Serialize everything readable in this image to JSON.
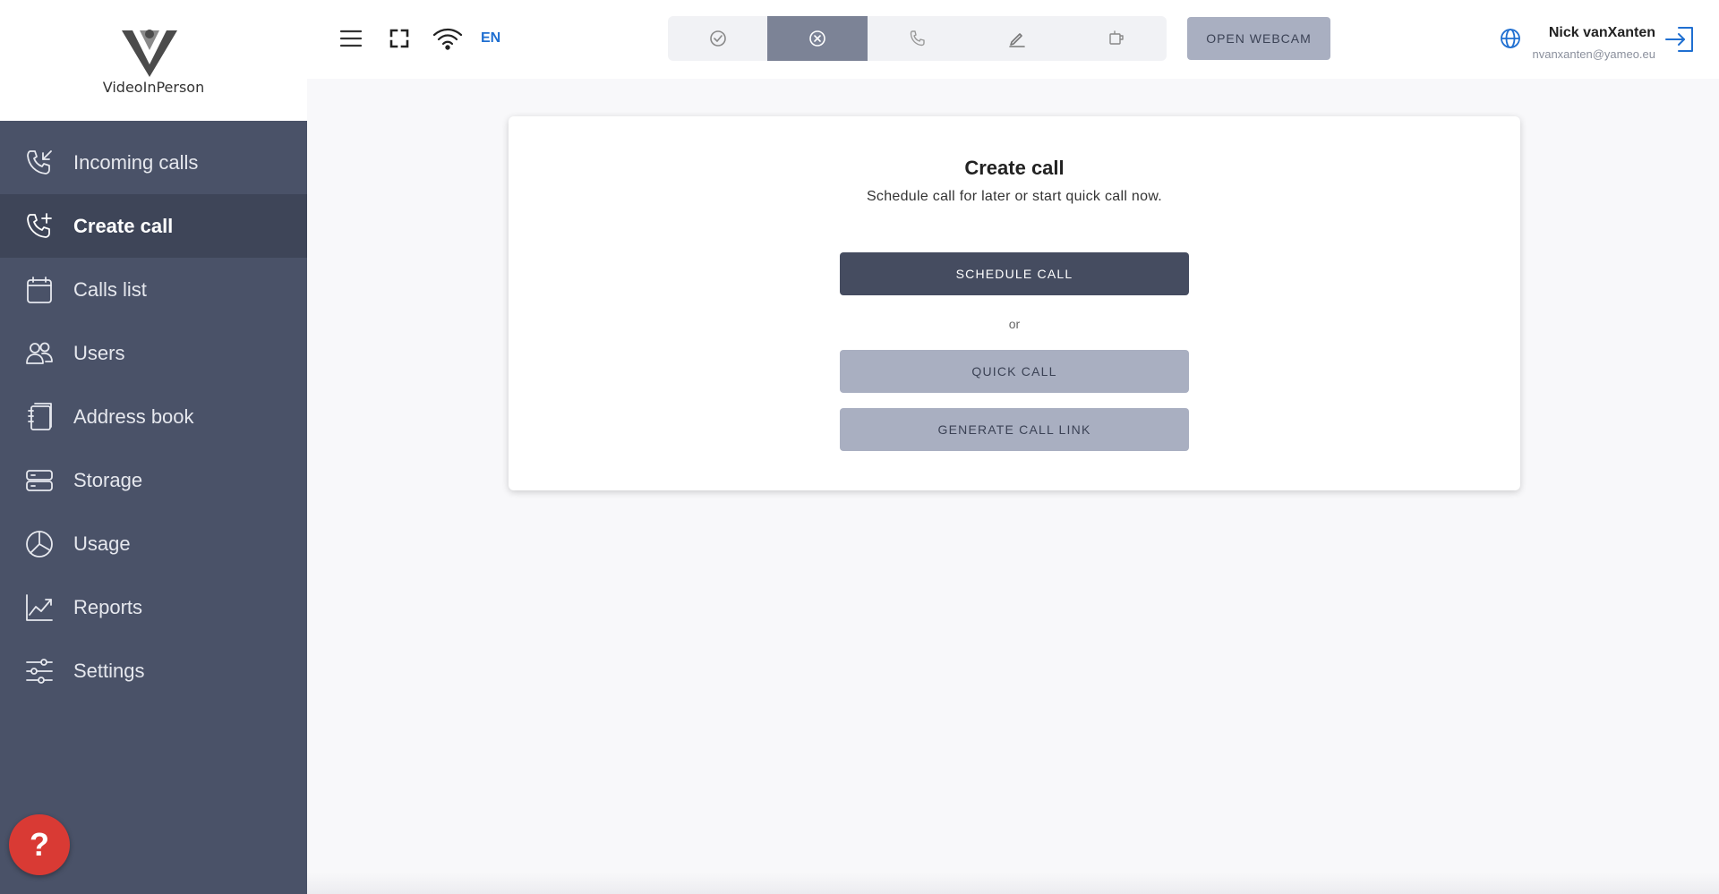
{
  "app": {
    "logo_text": "VideoInPerson",
    "brand_color": "#4a5268",
    "accent_color": "#1f6fd1",
    "help_label": "?"
  },
  "sidebar": {
    "items": [
      {
        "label": "Incoming calls",
        "icon": "incoming-call-icon",
        "active": false
      },
      {
        "label": "Create call",
        "icon": "add-call-icon",
        "active": true
      },
      {
        "label": "Calls list",
        "icon": "calendar-icon",
        "active": false
      },
      {
        "label": "Users",
        "icon": "users-icon",
        "active": false
      },
      {
        "label": "Address book",
        "icon": "address-book-icon",
        "active": false
      },
      {
        "label": "Storage",
        "icon": "storage-icon",
        "active": false
      },
      {
        "label": "Usage",
        "icon": "pie-chart-icon",
        "active": false
      },
      {
        "label": "Reports",
        "icon": "line-chart-icon",
        "active": false
      },
      {
        "label": "Settings",
        "icon": "sliders-icon",
        "active": false
      }
    ]
  },
  "topbar": {
    "language": "EN",
    "status_buttons": [
      {
        "icon": "check-circle-icon",
        "active": false
      },
      {
        "icon": "x-circle-icon",
        "active": true
      },
      {
        "icon": "phone-icon",
        "active": false
      },
      {
        "icon": "pencil-icon",
        "active": false
      },
      {
        "icon": "coffee-icon",
        "active": false
      }
    ],
    "webcam_label": "OPEN WEBCAM",
    "user_name": "Nick vanXanten",
    "user_email": "nvanxanten@yameo.eu"
  },
  "card": {
    "title": "Create call",
    "subtitle": "Schedule call for later or start quick call now.",
    "schedule_label": "SCHEDULE CALL",
    "or_label": "or",
    "quick_label": "QUICK CALL",
    "link_label": "GENERATE CALL LINK"
  }
}
